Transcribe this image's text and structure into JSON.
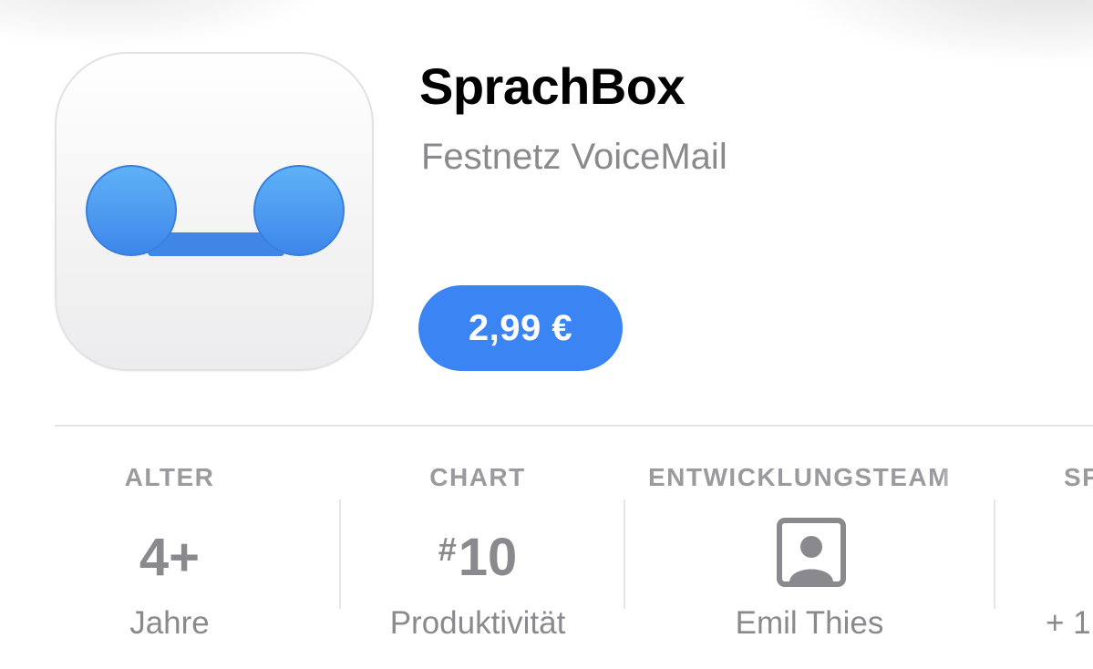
{
  "app": {
    "title": "SprachBox",
    "subtitle": "Festnetz VoiceMail",
    "price_label": "2,99 €",
    "icon": "voicemail-icon",
    "accent_color": "#3a84f3"
  },
  "info": {
    "age": {
      "header": "ALTER",
      "value": "4+",
      "sub": "Jahre"
    },
    "chart": {
      "header": "CHART",
      "hash": "#",
      "value": "10",
      "sub": "Produktivität"
    },
    "developer": {
      "header": "ENTWICKLUNGSTEAM",
      "icon": "person-icon",
      "sub": "Emil Thies"
    },
    "language": {
      "header": "SP",
      "sub": "+ 1"
    }
  }
}
